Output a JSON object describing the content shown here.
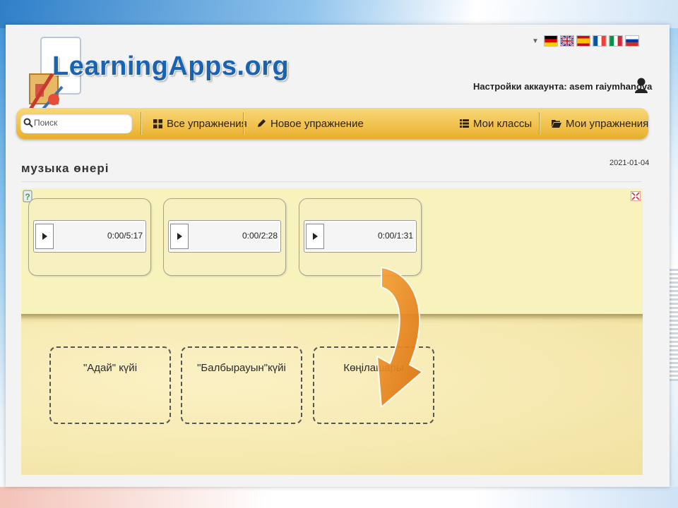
{
  "header": {
    "logo_text": "LearningApps.org",
    "account_label": "Настройки аккаунта: asem raiymhanova",
    "languages": [
      {
        "name": "German",
        "icon": "flag-de-icon"
      },
      {
        "name": "English",
        "icon": "flag-gb-icon"
      },
      {
        "name": "Spanish",
        "icon": "flag-es-icon"
      },
      {
        "name": "French",
        "icon": "flag-fr-icon"
      },
      {
        "name": "Italian",
        "icon": "flag-it-icon"
      },
      {
        "name": "Russian",
        "icon": "flag-ru-icon"
      }
    ]
  },
  "nav": {
    "search_placeholder": "Поиск",
    "all_exercises": "Все упражнения",
    "new_exercise": "Новое упражнение",
    "my_classes": "Мои классы",
    "my_exercises": "Мои упражнения"
  },
  "page": {
    "title": "музыка өнері",
    "date": "2021-01-04"
  },
  "audio_items": [
    {
      "time": "0:00/5:17"
    },
    {
      "time": "0:00/2:28"
    },
    {
      "time": "0:00/1:31"
    }
  ],
  "drop_targets": [
    {
      "label": "\"Адай\" күйі"
    },
    {
      "label": "\"Балбырауын\"күйі"
    },
    {
      "label": "Көңілашары"
    }
  ],
  "colors": {
    "nav_bar": "#f2c24f",
    "logo_blue": "#1a63b3",
    "app_background": "#f8f3bd",
    "arrow_orange": "#ef8a18"
  }
}
